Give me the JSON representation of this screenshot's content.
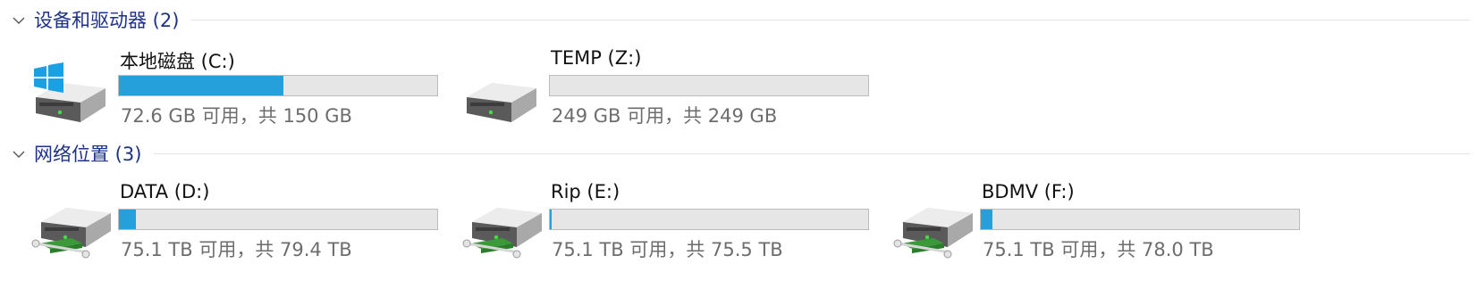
{
  "groups": [
    {
      "title": "设备和驱动器 (2)",
      "drives": [
        {
          "name": "本地磁盘 (C:)",
          "info": "72.6 GB 可用，共 150 GB",
          "used_fraction": 0.516,
          "icon": "windows-system-drive-icon"
        },
        {
          "name": "TEMP (Z:)",
          "info": "249 GB 可用，共 249 GB",
          "used_fraction": 0.0,
          "icon": "hard-drive-icon"
        }
      ]
    },
    {
      "title": "网络位置 (3)",
      "drives": [
        {
          "name": "DATA (D:)",
          "info": "75.1 TB 可用，共 79.4 TB",
          "used_fraction": 0.054,
          "icon": "network-drive-icon"
        },
        {
          "name": "Rip (E:)",
          "info": "75.1 TB 可用，共 75.5 TB",
          "used_fraction": 0.005,
          "icon": "network-drive-icon"
        },
        {
          "name": "BDMV (F:)",
          "info": "75.1 TB 可用，共 78.0 TB",
          "used_fraction": 0.037,
          "icon": "network-drive-icon"
        }
      ]
    }
  ],
  "colors": {
    "group_title": "#1e3287",
    "bar_fill": "#26a0da",
    "bar_background": "#e6e6e6",
    "secondary_text": "#6d6d6d"
  }
}
